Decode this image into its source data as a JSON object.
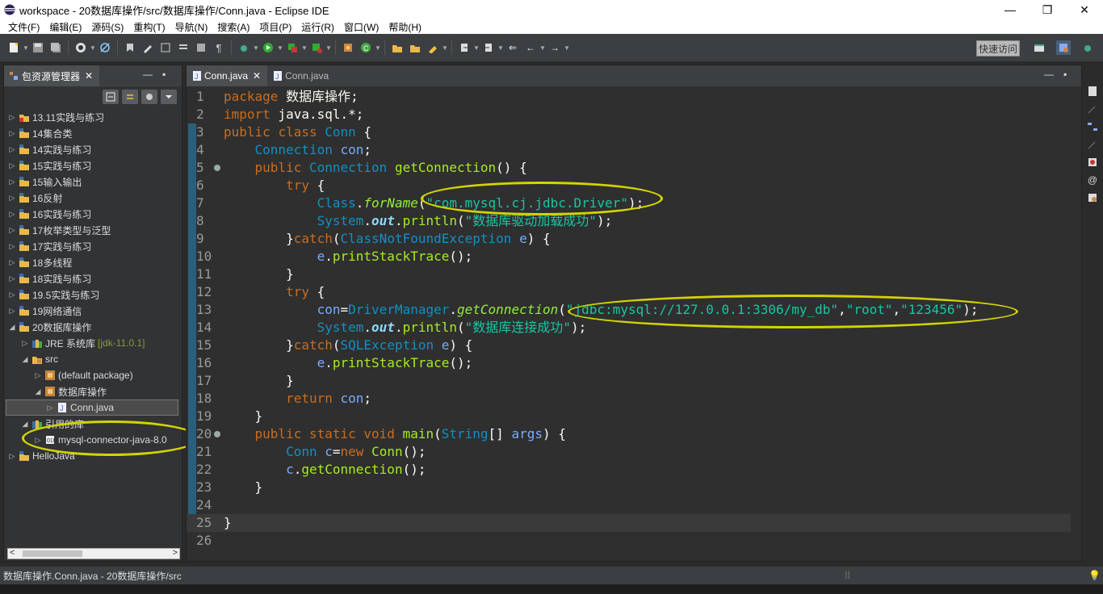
{
  "window": {
    "title": "workspace - 20数据库操作/src/数据库操作/Conn.java - Eclipse IDE",
    "minimize": "—",
    "restore": "❐",
    "close": "✕"
  },
  "menubar": [
    "文件(F)",
    "编辑(E)",
    "源码(S)",
    "重构(T)",
    "导航(N)",
    "搜索(A)",
    "项目(P)",
    "运行(R)",
    "窗口(W)",
    "帮助(H)"
  ],
  "toolbar": {
    "quick_access": "快速访问"
  },
  "package_explorer": {
    "tab_label": "包资源管理器",
    "tree": [
      {
        "label": "13.11实践与练习",
        "level": 0,
        "expanded": false,
        "icon": "project-error-icon"
      },
      {
        "label": "14集合类",
        "level": 0,
        "expanded": false,
        "icon": "project-icon"
      },
      {
        "label": "14实践与练习",
        "level": 0,
        "expanded": false,
        "icon": "project-icon"
      },
      {
        "label": "15实践与练习",
        "level": 0,
        "expanded": false,
        "icon": "project-icon"
      },
      {
        "label": "15输入输出",
        "level": 0,
        "expanded": false,
        "icon": "project-icon"
      },
      {
        "label": "16反射",
        "level": 0,
        "expanded": false,
        "icon": "project-icon"
      },
      {
        "label": "16实践与练习",
        "level": 0,
        "expanded": false,
        "icon": "project-icon"
      },
      {
        "label": "17枚举类型与泛型",
        "level": 0,
        "expanded": false,
        "icon": "project-icon"
      },
      {
        "label": "17实践与练习",
        "level": 0,
        "expanded": false,
        "icon": "project-icon"
      },
      {
        "label": "18多线程",
        "level": 0,
        "expanded": false,
        "icon": "project-icon"
      },
      {
        "label": "18实践与练习",
        "level": 0,
        "expanded": false,
        "icon": "project-icon"
      },
      {
        "label": "19.5实践与练习",
        "level": 0,
        "expanded": false,
        "icon": "project-icon"
      },
      {
        "label": "19网络通信",
        "level": 0,
        "expanded": false,
        "icon": "project-icon"
      },
      {
        "label": "20数据库操作",
        "level": 0,
        "expanded": true,
        "icon": "project-icon"
      },
      {
        "label": "JRE 系统库",
        "decor": "[jdk-11.0.1]",
        "level": 1,
        "expanded": false,
        "icon": "library-icon"
      },
      {
        "label": "src",
        "level": 1,
        "expanded": true,
        "icon": "source-folder-icon"
      },
      {
        "label": "(default package)",
        "level": 2,
        "expanded": false,
        "icon": "package-icon"
      },
      {
        "label": "数据库操作",
        "level": 2,
        "expanded": true,
        "icon": "package-icon"
      },
      {
        "label": "Conn.java",
        "level": 3,
        "expanded": false,
        "icon": "java-file-icon",
        "selected": true
      },
      {
        "label": "引用的库",
        "level": 1,
        "expanded": true,
        "icon": "library-icon"
      },
      {
        "label": "mysql-connector-java-8.0",
        "level": 2,
        "expanded": false,
        "icon": "jar-icon"
      },
      {
        "label": "HelloJava",
        "level": 0,
        "expanded": false,
        "icon": "project-icon"
      }
    ]
  },
  "editor": {
    "tabs": [
      {
        "label": "Conn.java",
        "active": true,
        "closable": true
      },
      {
        "label": "Conn.java",
        "active": false,
        "closable": false
      }
    ],
    "current_line": 25,
    "lines": [
      [
        [
          "kw",
          "package"
        ],
        [
          "pl",
          " 数据库操作;"
        ]
      ],
      [
        [
          "kw",
          "import"
        ],
        [
          "pl",
          " java.sql.*;"
        ]
      ],
      [
        [
          "kw",
          "public"
        ],
        [
          "pl",
          " "
        ],
        [
          "kw",
          "class"
        ],
        [
          "pl",
          " "
        ],
        [
          "ty",
          "Conn"
        ],
        [
          "pl",
          " {"
        ]
      ],
      [
        [
          "pl",
          "    "
        ],
        [
          "ty",
          "Connection"
        ],
        [
          "pl",
          " "
        ],
        [
          "var",
          "con"
        ],
        [
          "pl",
          ";"
        ]
      ],
      [
        [
          "pl",
          "    "
        ],
        [
          "kw",
          "public"
        ],
        [
          "pl",
          " "
        ],
        [
          "ty",
          "Connection"
        ],
        [
          "pl",
          " "
        ],
        [
          "fn",
          "getConnection"
        ],
        [
          "pl",
          "() {"
        ]
      ],
      [
        [
          "pl",
          "        "
        ],
        [
          "kw",
          "try"
        ],
        [
          "pl",
          " {"
        ]
      ],
      [
        [
          "pl",
          "            "
        ],
        [
          "ty",
          "Class"
        ],
        [
          "pl",
          "."
        ],
        [
          "sm",
          "forName"
        ],
        [
          "pl",
          "("
        ],
        [
          "str",
          "\"com.mysql.cj.jdbc.Driver\""
        ],
        [
          "pl",
          ");"
        ]
      ],
      [
        [
          "pl",
          "            "
        ],
        [
          "ty",
          "System"
        ],
        [
          "pl",
          "."
        ],
        [
          "fld",
          "out"
        ],
        [
          "pl",
          "."
        ],
        [
          "fn",
          "println"
        ],
        [
          "pl",
          "("
        ],
        [
          "str",
          "\"数据库驱动加载成功\""
        ],
        [
          "pl",
          ");"
        ]
      ],
      [
        [
          "pl",
          "        }"
        ],
        [
          "kw",
          "catch"
        ],
        [
          "pl",
          "("
        ],
        [
          "ty",
          "ClassNotFoundException"
        ],
        [
          "pl",
          " "
        ],
        [
          "var",
          "e"
        ],
        [
          "pl",
          ") {"
        ]
      ],
      [
        [
          "pl",
          "            "
        ],
        [
          "var",
          "e"
        ],
        [
          "pl",
          "."
        ],
        [
          "fn",
          "printStackTrace"
        ],
        [
          "pl",
          "();"
        ]
      ],
      [
        [
          "pl",
          "        }"
        ]
      ],
      [
        [
          "pl",
          "        "
        ],
        [
          "kw",
          "try"
        ],
        [
          "pl",
          " {"
        ]
      ],
      [
        [
          "pl",
          "            "
        ],
        [
          "var",
          "con"
        ],
        [
          "pl",
          "="
        ],
        [
          "ty",
          "DriverManager"
        ],
        [
          "pl",
          "."
        ],
        [
          "sm",
          "getConnection"
        ],
        [
          "pl",
          "("
        ],
        [
          "str",
          "\"jdbc:mysql://127.0.0.1:3306/my_db\""
        ],
        [
          "pl",
          ","
        ],
        [
          "str",
          "\"root\""
        ],
        [
          "pl",
          ","
        ],
        [
          "str",
          "\"123456\""
        ],
        [
          "pl",
          ");"
        ]
      ],
      [
        [
          "pl",
          "            "
        ],
        [
          "ty",
          "System"
        ],
        [
          "pl",
          "."
        ],
        [
          "fld",
          "out"
        ],
        [
          "pl",
          "."
        ],
        [
          "fn",
          "println"
        ],
        [
          "pl",
          "("
        ],
        [
          "str",
          "\"数据库连接成功\""
        ],
        [
          "pl",
          ");"
        ]
      ],
      [
        [
          "pl",
          "        }"
        ],
        [
          "kw",
          "catch"
        ],
        [
          "pl",
          "("
        ],
        [
          "ty",
          "SQLException"
        ],
        [
          "pl",
          " "
        ],
        [
          "var",
          "e"
        ],
        [
          "pl",
          ") {"
        ]
      ],
      [
        [
          "pl",
          "            "
        ],
        [
          "var",
          "e"
        ],
        [
          "pl",
          "."
        ],
        [
          "fn",
          "printStackTrace"
        ],
        [
          "pl",
          "();"
        ]
      ],
      [
        [
          "pl",
          "        }"
        ]
      ],
      [
        [
          "pl",
          "        "
        ],
        [
          "kw",
          "return"
        ],
        [
          "pl",
          " "
        ],
        [
          "var",
          "con"
        ],
        [
          "pl",
          ";"
        ]
      ],
      [
        [
          "pl",
          "    }"
        ]
      ],
      [
        [
          "pl",
          "    "
        ],
        [
          "kw",
          "public"
        ],
        [
          "pl",
          " "
        ],
        [
          "kw",
          "static"
        ],
        [
          "pl",
          " "
        ],
        [
          "kw",
          "void"
        ],
        [
          "pl",
          " "
        ],
        [
          "fn",
          "main"
        ],
        [
          "pl",
          "("
        ],
        [
          "ty",
          "String"
        ],
        [
          "pl",
          "[] "
        ],
        [
          "var",
          "args"
        ],
        [
          "pl",
          ") {"
        ]
      ],
      [
        [
          "pl",
          "        "
        ],
        [
          "ty",
          "Conn"
        ],
        [
          "pl",
          " "
        ],
        [
          "var",
          "c"
        ],
        [
          "pl",
          "="
        ],
        [
          "kw",
          "new"
        ],
        [
          "pl",
          " "
        ],
        [
          "fn",
          "Conn"
        ],
        [
          "pl",
          "();"
        ]
      ],
      [
        [
          "pl",
          "        "
        ],
        [
          "var",
          "c"
        ],
        [
          "pl",
          "."
        ],
        [
          "fn",
          "getConnection"
        ],
        [
          "pl",
          "();"
        ]
      ],
      [
        [
          "pl",
          "    }"
        ]
      ],
      [
        [
          "pl",
          ""
        ]
      ],
      [
        [
          "pl",
          "}"
        ]
      ],
      [
        [
          "pl",
          ""
        ]
      ]
    ]
  },
  "statusbar": {
    "text": "数据库操作.Conn.java - 20数据库操作/src"
  },
  "colors": {
    "annotation": "#d4d400",
    "keyword": "#cc6c1d",
    "string": "#17c6a3",
    "type": "#1290c3"
  }
}
